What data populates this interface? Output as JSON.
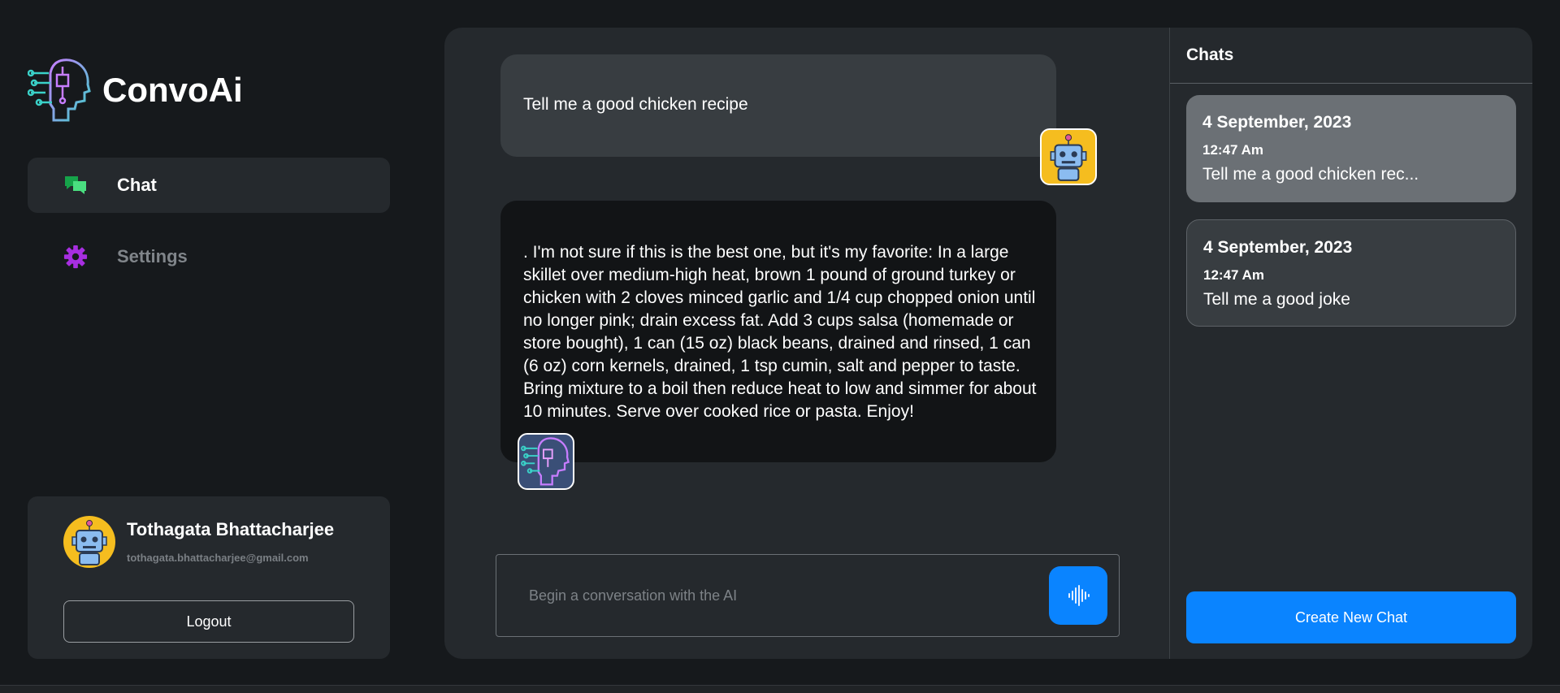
{
  "brand": {
    "name": "ConvoAi",
    "logo_icon": "ai-head-circuit-icon"
  },
  "nav": {
    "items": [
      {
        "label": "Chat",
        "icon": "chat-bubbles-icon",
        "active": true,
        "icon_color": "#22c55e"
      },
      {
        "label": "Settings",
        "icon": "gear-icon",
        "active": false,
        "icon_color": "#a72ee0"
      }
    ]
  },
  "profile": {
    "name": "Tothagata Bhattacharjee",
    "email": "tothagata.bhattacharjee@gmail.com",
    "avatar_icon": "robot-avatar-icon",
    "logout_label": "Logout"
  },
  "messages": [
    {
      "role": "user",
      "text": "Tell me a good chicken recipe",
      "avatar_icon": "robot-avatar-icon"
    },
    {
      "role": "ai",
      "text": ". I'm not sure if this is the best one, but it's my favorite: In a large skillet over medium-high heat, brown 1 pound of ground turkey or chicken with 2 cloves minced garlic and 1/4 cup chopped onion until no longer pink; drain excess fat. Add 3 cups salsa (homemade or store bought), 1 can (15 oz) black beans, drained and rinsed, 1 can (6 oz) corn kernels, drained, 1 tsp cumin, salt and pepper to taste. Bring mixture to a boil then reduce heat to low and simmer for about 10 minutes. Serve over cooked rice or pasta. Enjoy!",
      "avatar_icon": "ai-head-circuit-icon"
    }
  ],
  "composer": {
    "placeholder": "Begin a conversation with the AI",
    "mic_icon": "voice-wave-icon"
  },
  "chats": {
    "header": "Chats",
    "items": [
      {
        "date": "4 September, 2023",
        "time": "12:47 Am",
        "preview": "Tell me a good chicken rec...",
        "selected": true
      },
      {
        "date": "4 September, 2023",
        "time": "12:47 Am",
        "preview": "Tell me a good joke",
        "selected": false
      }
    ],
    "new_chat_label": "Create New Chat"
  },
  "colors": {
    "accent": "#0a84ff",
    "background": "#16191c",
    "panel": "#25292d"
  }
}
